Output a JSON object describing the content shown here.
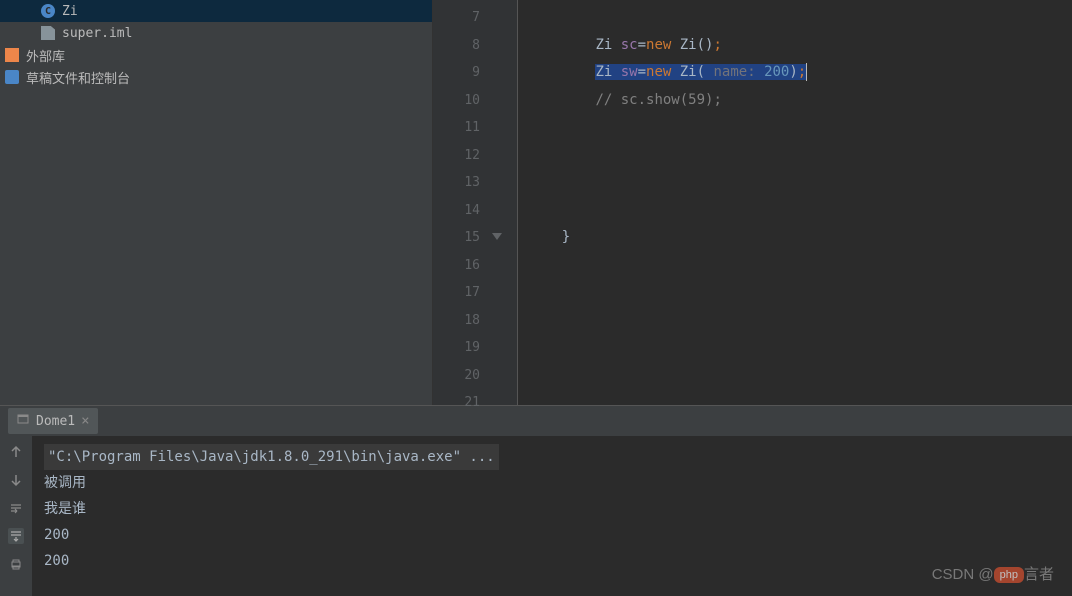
{
  "sidebar": {
    "items": [
      {
        "label": "Zi",
        "icon": "class"
      },
      {
        "label": "super.iml",
        "icon": "file"
      },
      {
        "label": "外部库",
        "icon": "lib"
      },
      {
        "label": "草稿文件和控制台",
        "icon": "scratch"
      }
    ]
  },
  "editor": {
    "firstLineNum": 7,
    "lastLineNum": 21,
    "lines": {
      "7": "",
      "8": {
        "indent": "        ",
        "t1": "Zi ",
        "v1": "sc",
        "t2": "=",
        "kw": "new",
        "t3": " Zi()",
        "semi": ";"
      },
      "9": {
        "indent": "        ",
        "t1": "Zi ",
        "v1": "sw",
        "t2": "=",
        "kw": "new",
        "t3": " Zi( ",
        "param": "name: ",
        "num": "200",
        "t4": ")",
        "semi": ";"
      },
      "10": {
        "indent": "        ",
        "comment": "// sc.show(59);"
      },
      "15": {
        "indent": "    ",
        "brace": "}"
      }
    }
  },
  "console": {
    "tab": {
      "label": "Dome1"
    },
    "output": [
      {
        "text": "\"C:\\Program Files\\Java\\jdk1.8.0_291\\bin\\java.exe\" ...",
        "path": true
      },
      {
        "text": "被调用"
      },
      {
        "text": "我是谁"
      },
      {
        "text": "200"
      },
      {
        "text": "200"
      }
    ]
  },
  "watermark": {
    "prefix": "CSDN @",
    "badge": "php",
    "suffix": "言者"
  }
}
